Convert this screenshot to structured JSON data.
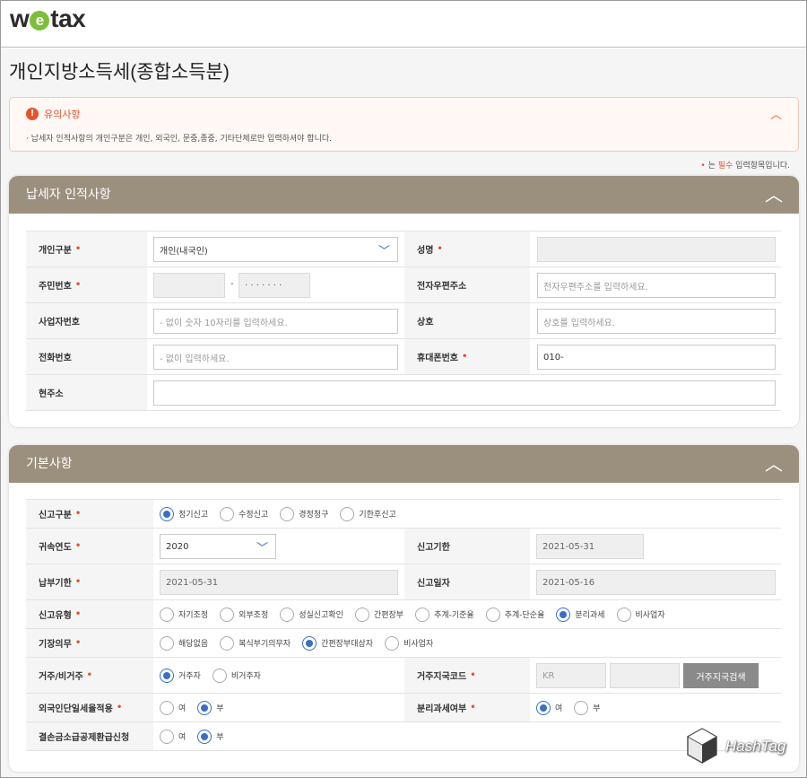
{
  "brand": {
    "prefix": "w",
    "e": "e",
    "suffix": "tax"
  },
  "page_title": "개인지방소득세(종합소득분)",
  "notice": {
    "title": "유의사항",
    "text": "· 납세자 인적사항의 개인구분은 개인, 외국인, 문중,종중, 기타단체로만 입력하셔야 합니다."
  },
  "required_note": {
    "star": "•",
    "pre": " 는 ",
    "word": "필수",
    "post": " 입력항목입니다."
  },
  "section1": {
    "title": "납세자 인적사항",
    "labels": {
      "type": "개인구분",
      "name": "성명",
      "rrn": "주민번호",
      "postcode": "전자우편주소",
      "bizno": "사업자번호",
      "company": "상호",
      "phone": "전화번호",
      "mobile": "휴대폰번호",
      "address": "현주소"
    },
    "type_value": "개인(내국인)",
    "rrn_dash": "-",
    "rrn_back": "· · · · · · ·",
    "email_placeholder": "전자우편주소를 입력하세요.",
    "bizno_placeholder": "- 없이 숫자 10자리를 입력하세요.",
    "company_placeholder": "상호를 입력하세요.",
    "phone_placeholder": "- 없이 입력하세요.",
    "mobile_value": "010-"
  },
  "section2": {
    "title": "기본사항",
    "labels": {
      "report_type": "신고구분",
      "year": "귀속연도",
      "deadline": "신고기한",
      "pay_deadline": "납부기한",
      "report_date": "신고일자",
      "report_kind": "신고유형",
      "bookkeeping": "기장의무",
      "residence": "거주/비거주",
      "country_code": "거주지국코드",
      "foreign_rate": "외국인단일세율적용",
      "separate_tax": "분리과세여부",
      "loss_refund": "결손금소급공제환급신청"
    },
    "report_type_options": [
      "정기신고",
      "수정신고",
      "경정청구",
      "기한후신고"
    ],
    "year_value": "2020",
    "deadline_value": "2021-05-31",
    "pay_deadline_value": "2021-05-31",
    "report_date_value": "2021-05-16",
    "report_kind_options": [
      "자기조정",
      "외부조정",
      "성실신고확인",
      "간편장부",
      "추계-기준율",
      "추계-단순율",
      "분리과세",
      "비사업자"
    ],
    "bookkeeping_options": [
      "해당없음",
      "복식부기의무자",
      "간편장부대상자",
      "비사업자"
    ],
    "residence_options": [
      "거주자",
      "비거주자"
    ],
    "country_code_value": "KR",
    "country_search_button": "거주지국검색",
    "yes": "여",
    "no": "부"
  },
  "watermark": "HashTag"
}
